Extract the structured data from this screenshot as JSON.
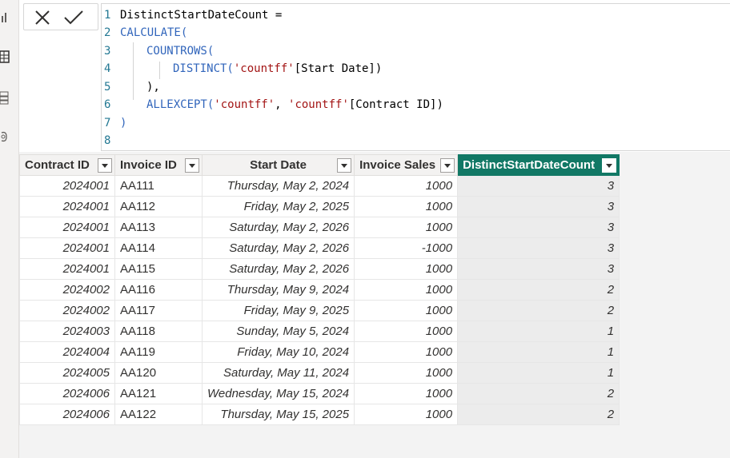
{
  "formula_bar": {
    "cancel_icon": "close-icon",
    "commit_icon": "checkmark-icon",
    "line_numbers": [
      "1",
      "2",
      "3",
      "4",
      "5",
      "6",
      "7",
      "8"
    ],
    "lines": {
      "l1": "DistinctStartDateCount =",
      "l2_fn": "CALCULATE(",
      "l3_fn": "COUNTROWS(",
      "l4_fn": "DISTINCT(",
      "l4_arg": "'countff'",
      "l4_col": "[Start Date])",
      "l5": "),",
      "l6_fn": "ALLEXCEPT(",
      "l6_arg1": "'countff'",
      "l6_sep": ", ",
      "l6_arg2": "'countff'",
      "l6_col": "[Contract ID])",
      "l7": ")"
    }
  },
  "left_rail": {
    "icons": [
      "report-view-icon",
      "table-view-icon",
      "model-view-icon",
      "dax-query-icon"
    ]
  },
  "table": {
    "columns": [
      {
        "label": "Contract ID",
        "filter_icon": "chevron-down-icon"
      },
      {
        "label": "Invoice ID",
        "filter_icon": "chevron-down-icon"
      },
      {
        "label": "Start Date",
        "filter_icon": "chevron-down-icon"
      },
      {
        "label": "Invoice Sales",
        "filter_icon": "chevron-down-icon"
      },
      {
        "label": "DistinctStartDateCount",
        "filter_icon": "chevron-down-icon"
      }
    ],
    "rows": [
      [
        "2024001",
        "AA111",
        "Thursday, May 2, 2024",
        "1000",
        "3"
      ],
      [
        "2024001",
        "AA112",
        "Friday, May 2, 2025",
        "1000",
        "3"
      ],
      [
        "2024001",
        "AA113",
        "Saturday, May 2, 2026",
        "1000",
        "3"
      ],
      [
        "2024001",
        "AA114",
        "Saturday, May 2, 2026",
        "-1000",
        "3"
      ],
      [
        "2024001",
        "AA115",
        "Saturday, May 2, 2026",
        "1000",
        "3"
      ],
      [
        "2024002",
        "AA116",
        "Thursday, May 9, 2024",
        "1000",
        "2"
      ],
      [
        "2024002",
        "AA117",
        "Friday, May 9, 2025",
        "1000",
        "2"
      ],
      [
        "2024003",
        "AA118",
        "Sunday, May 5, 2024",
        "1000",
        "1"
      ],
      [
        "2024004",
        "AA119",
        "Friday, May 10, 2024",
        "1000",
        "1"
      ],
      [
        "2024005",
        "AA120",
        "Saturday, May 11, 2024",
        "1000",
        "1"
      ],
      [
        "2024006",
        "AA121",
        "Wednesday, May 15, 2024",
        "1000",
        "2"
      ],
      [
        "2024006",
        "AA122",
        "Thursday, May 15, 2025",
        "1000",
        "2"
      ]
    ],
    "selected_column_color": "#117865"
  }
}
